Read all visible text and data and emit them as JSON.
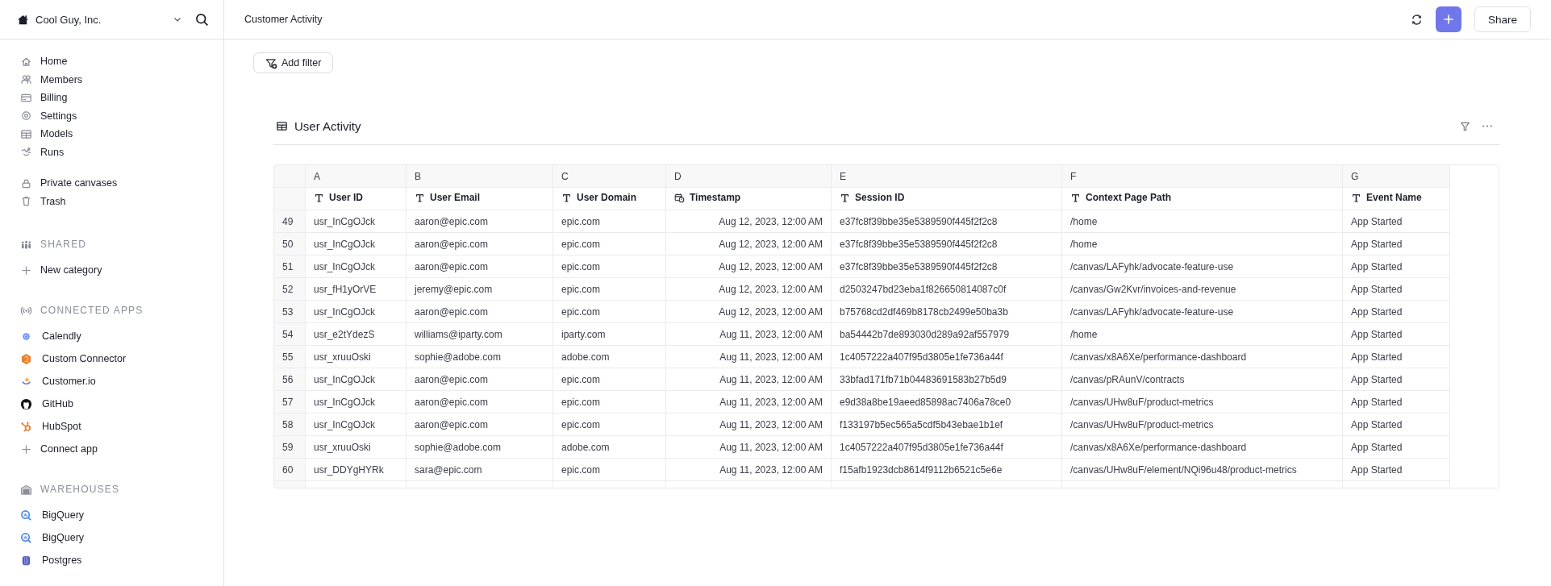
{
  "sidebar": {
    "workspace": "Cool Guy, Inc.",
    "nav": [
      {
        "label": "Home"
      },
      {
        "label": "Members"
      },
      {
        "label": "Billing"
      },
      {
        "label": "Settings"
      },
      {
        "label": "Models"
      },
      {
        "label": "Runs"
      }
    ],
    "private": [
      {
        "label": "Private canvases"
      },
      {
        "label": "Trash"
      }
    ],
    "sections": [
      {
        "title": "SHARED",
        "items": [
          {
            "label": "New category",
            "kind": "add"
          }
        ]
      },
      {
        "title": "CONNECTED APPS",
        "items": [
          {
            "label": "Calendly",
            "kind": "source"
          },
          {
            "label": "Custom Connector",
            "kind": "source"
          },
          {
            "label": "Customer.io",
            "kind": "source"
          },
          {
            "label": "GitHub",
            "kind": "source"
          },
          {
            "label": "HubSpot",
            "kind": "source"
          },
          {
            "label": "Connect app",
            "kind": "add"
          }
        ]
      },
      {
        "title": "WAREHOUSES",
        "items": [
          {
            "label": "BigQuery",
            "kind": "source"
          },
          {
            "label": "BigQuery",
            "kind": "source"
          },
          {
            "label": "Postgres",
            "kind": "source"
          }
        ]
      }
    ]
  },
  "header": {
    "title": "Customer Activity",
    "share": "Share"
  },
  "toolbar": {
    "add_filter": "Add filter"
  },
  "table": {
    "title": "User Activity",
    "columns": [
      {
        "letter": "A",
        "name": "User ID",
        "kind": "text"
      },
      {
        "letter": "B",
        "name": "User Email",
        "kind": "text"
      },
      {
        "letter": "C",
        "name": "User Domain",
        "kind": "text"
      },
      {
        "letter": "D",
        "name": "Timestamp",
        "kind": "date"
      },
      {
        "letter": "E",
        "name": "Session ID",
        "kind": "text"
      },
      {
        "letter": "F",
        "name": "Context Page Path",
        "kind": "text"
      },
      {
        "letter": "G",
        "name": "Event Name",
        "kind": "text"
      }
    ],
    "rows": [
      {
        "n": "49",
        "cells": [
          "usr_InCgOJck",
          "aaron@epic.com",
          "epic.com",
          "Aug 12, 2023, 12:00 AM",
          "e37fc8f39bbe35e5389590f445f2f2c8",
          "/home",
          "App Started"
        ]
      },
      {
        "n": "50",
        "cells": [
          "usr_InCgOJck",
          "aaron@epic.com",
          "epic.com",
          "Aug 12, 2023, 12:00 AM",
          "e37fc8f39bbe35e5389590f445f2f2c8",
          "/home",
          "App Started"
        ]
      },
      {
        "n": "51",
        "cells": [
          "usr_InCgOJck",
          "aaron@epic.com",
          "epic.com",
          "Aug 12, 2023, 12:00 AM",
          "e37fc8f39bbe35e5389590f445f2f2c8",
          "/canvas/LAFyhk/advocate-feature-use",
          "App Started"
        ]
      },
      {
        "n": "52",
        "cells": [
          "usr_fH1yOrVE",
          "jeremy@epic.com",
          "epic.com",
          "Aug 12, 2023, 12:00 AM",
          "d2503247bd23eba1f826650814087c0f",
          "/canvas/Gw2Kvr/invoices-and-revenue",
          "App Started"
        ]
      },
      {
        "n": "53",
        "cells": [
          "usr_InCgOJck",
          "aaron@epic.com",
          "epic.com",
          "Aug 12, 2023, 12:00 AM",
          "b75768cd2df469b8178cb2499e50ba3b",
          "/canvas/LAFyhk/advocate-feature-use",
          "App Started"
        ]
      },
      {
        "n": "54",
        "cells": [
          "usr_e2tYdezS",
          "williams@iparty.com",
          "iparty.com",
          "Aug 11, 2023, 12:00 AM",
          "ba54442b7de893030d289a92af557979",
          "/home",
          "App Started"
        ]
      },
      {
        "n": "55",
        "cells": [
          "usr_xruuOski",
          "sophie@adobe.com",
          "adobe.com",
          "Aug 11, 2023, 12:00 AM",
          "1c4057222a407f95d3805e1fe736a44f",
          "/canvas/x8A6Xe/performance-dashboard",
          "App Started"
        ]
      },
      {
        "n": "56",
        "cells": [
          "usr_InCgOJck",
          "aaron@epic.com",
          "epic.com",
          "Aug 11, 2023, 12:00 AM",
          "33bfad171fb71b04483691583b27b5d9",
          "/canvas/pRAunV/contracts",
          "App Started"
        ]
      },
      {
        "n": "57",
        "cells": [
          "usr_InCgOJck",
          "aaron@epic.com",
          "epic.com",
          "Aug 11, 2023, 12:00 AM",
          "e9d38a8be19aeed85898ac7406a78ce0",
          "/canvas/UHw8uF/product-metrics",
          "App Started"
        ]
      },
      {
        "n": "58",
        "cells": [
          "usr_InCgOJck",
          "aaron@epic.com",
          "epic.com",
          "Aug 11, 2023, 12:00 AM",
          "f133197b5ec565a5cdf5b43ebae1b1ef",
          "/canvas/UHw8uF/product-metrics",
          "App Started"
        ]
      },
      {
        "n": "59",
        "cells": [
          "usr_xruuOski",
          "sophie@adobe.com",
          "adobe.com",
          "Aug 11, 2023, 12:00 AM",
          "1c4057222a407f95d3805e1fe736a44f",
          "/canvas/x8A6Xe/performance-dashboard",
          "App Started"
        ]
      },
      {
        "n": "60",
        "cells": [
          "usr_DDYgHYRk",
          "sara@epic.com",
          "epic.com",
          "Aug 11, 2023, 12:00 AM",
          "f15afb1923dcb8614f9112b6521c5e6e",
          "/canvas/UHw8uF/element/NQi96u48/product-metrics",
          "App Started"
        ]
      }
    ]
  }
}
